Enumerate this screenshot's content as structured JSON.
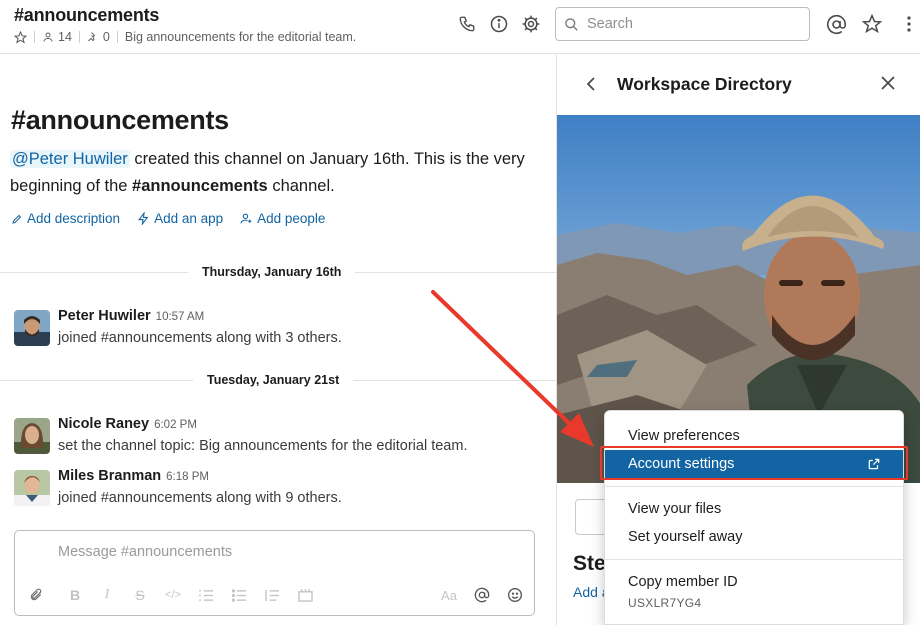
{
  "header": {
    "channel_title": "#announcements",
    "member_count": "14",
    "pinned_count": "0",
    "topic": "Big announcements for the editorial team.",
    "search_placeholder": "Search"
  },
  "intro": {
    "title": "#announcements",
    "mention": "@Peter Huwiler",
    "text_before": " created this channel on January 16th. This is the very beginning of the ",
    "channel_bold": "#announcements",
    "text_after": " channel.",
    "links": {
      "add_description": "Add description",
      "add_app": "Add an app",
      "add_people": "Add people"
    }
  },
  "timeline": {
    "day1": "Thursday, January 16th",
    "day2": "Tuesday, January 21st",
    "messages": [
      {
        "name": "Peter Huwiler",
        "time": "10:57 AM",
        "body": "joined #announcements along with 3 others."
      },
      {
        "name": "Nicole Raney",
        "time": "6:02 PM",
        "body": "set the channel topic: Big announcements for the editorial team."
      },
      {
        "name": "Miles Branman",
        "time": "6:18 PM",
        "body": "joined #announcements along with 9 others."
      }
    ]
  },
  "composer": {
    "placeholder": "Message #announcements",
    "font_size_label": "Aa"
  },
  "panel": {
    "title": "Workspace Directory",
    "name_partial": "Ste",
    "link_partial": "Add a"
  },
  "menu": {
    "view_preferences": "View preferences",
    "account_settings": "Account settings",
    "view_files": "View your files",
    "set_away": "Set yourself away",
    "copy_id": "Copy member ID",
    "member_id": "USXLR7YG4"
  },
  "colors": {
    "link": "#1264a3",
    "menu_active": "#1264a3",
    "annotation": "#e8392b"
  }
}
